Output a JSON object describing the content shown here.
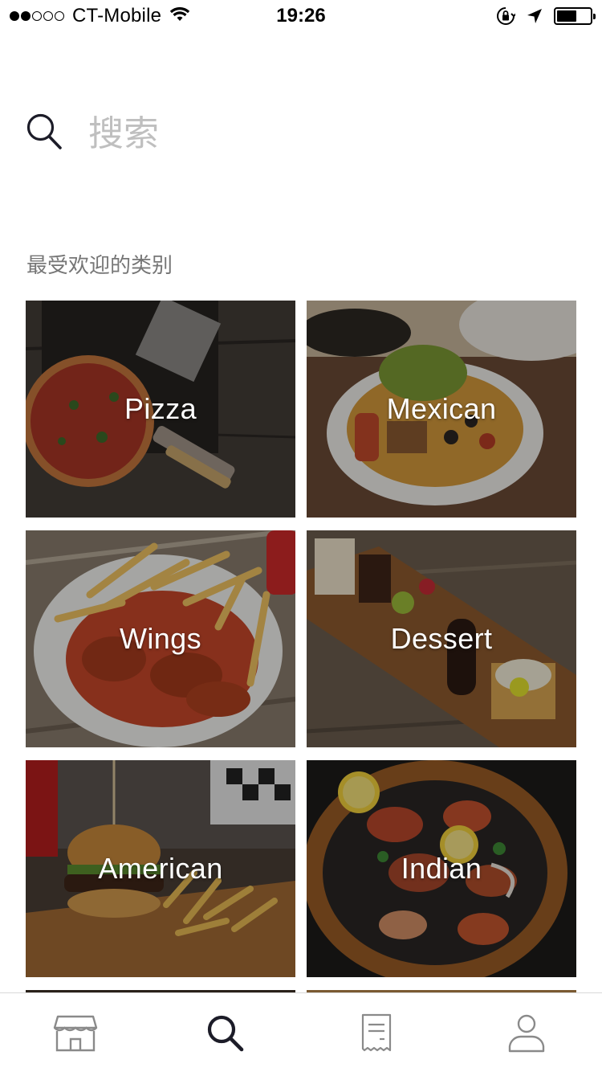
{
  "status_bar": {
    "carrier": "CT-Mobile",
    "time": "19:26",
    "signal_bars_filled": 2,
    "signal_bars_total": 5,
    "battery_level": 0.6,
    "icons": [
      "wifi-icon",
      "orientation-lock-icon",
      "location-arrow-icon",
      "battery-icon"
    ]
  },
  "search": {
    "placeholder": "搜索",
    "icon": "search-icon"
  },
  "categories_section": {
    "title": "最受欢迎的类别",
    "items": [
      {
        "label": "Pizza"
      },
      {
        "label": "Mexican"
      },
      {
        "label": "Wings"
      },
      {
        "label": "Dessert"
      },
      {
        "label": "American"
      },
      {
        "label": "Indian"
      }
    ]
  },
  "tab_bar": {
    "active_tab": "search",
    "tabs": [
      {
        "id": "home",
        "icon": "storefront-icon"
      },
      {
        "id": "search",
        "icon": "search-icon"
      },
      {
        "id": "orders",
        "icon": "receipt-icon"
      },
      {
        "id": "account",
        "icon": "person-icon"
      }
    ]
  },
  "colors": {
    "placeholder": "#bfbfbf",
    "section_title": "#767676",
    "active_tab_icon": "#1c1c28",
    "inactive_tab_icon": "#8a8a8a"
  }
}
